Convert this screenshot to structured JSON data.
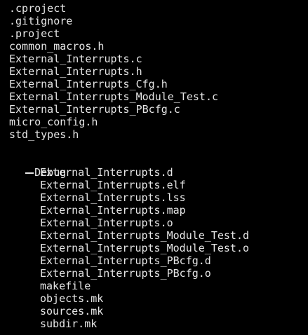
{
  "colors": {
    "background": "#000000",
    "text": "#e6e6e6"
  },
  "root_files": [
    ".cproject",
    ".gitignore",
    ".project",
    "common_macros.h",
    "External_Interrupts.c",
    "External_Interrupts.h",
    "External_Interrupts_Cfg.h",
    "External_Interrupts_Module_Test.c",
    "External_Interrupts_PBcfg.c",
    "micro_config.h",
    "std_types.h"
  ],
  "debug_folder": {
    "name": "Debug",
    "files": [
      "External_Interrupts.d",
      "External_Interrupts.elf",
      "External_Interrupts.lss",
      "External_Interrupts.map",
      "External_Interrupts.o",
      "External_Interrupts_Module_Test.d",
      "External_Interrupts_Module_Test.o",
      "External_Interrupts_PBcfg.d",
      "External_Interrupts_PBcfg.o",
      "makefile",
      "objects.mk",
      "sources.mk",
      "subdir.mk"
    ]
  }
}
